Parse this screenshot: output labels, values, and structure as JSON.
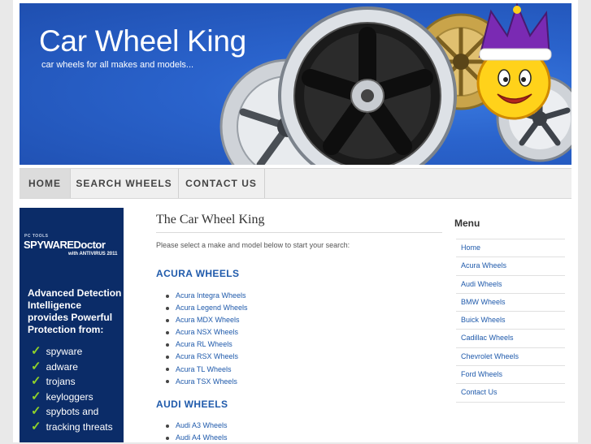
{
  "header": {
    "site_title": "Car Wheel King",
    "tagline": "car wheels for all makes and models..."
  },
  "nav": {
    "items": [
      {
        "label": "HOME",
        "active": true
      },
      {
        "label": "SEARCH WHEELS",
        "active": false
      },
      {
        "label": "CONTACT US",
        "active": false
      }
    ]
  },
  "ad": {
    "brand_small": "PC TOOLS",
    "brand": "SPYWAREDoctor",
    "brand_sub": "with ANTIVIRUS 2011",
    "headline": "Advanced Detection Intelligence provides Powerful Protection from:",
    "items": [
      "spyware",
      "adware",
      "trojans",
      "keyloggers",
      "spybots and",
      "tracking threats"
    ]
  },
  "main": {
    "title": "The Car Wheel King",
    "intro": "Please select a make and model below to start your search:",
    "sections": [
      {
        "title": "ACURA WHEELS",
        "items": [
          "Acura Integra Wheels",
          "Acura Legend Wheels",
          "Acura MDX Wheels",
          "Acura NSX Wheels",
          "Acura RL Wheels",
          "Acura RSX Wheels",
          "Acura TL Wheels",
          "Acura TSX Wheels"
        ]
      },
      {
        "title": "AUDI WHEELS",
        "items": [
          "Audi A3 Wheels",
          "Audi A4 Wheels"
        ]
      }
    ]
  },
  "sidebar": {
    "title": "Menu",
    "items": [
      "Home",
      "Acura Wheels",
      "Audi Wheels",
      "BMW Wheels",
      "Buick Wheels",
      "Cadillac Wheels",
      "Chevrolet Wheels",
      "Ford Wheels",
      "Contact Us"
    ]
  },
  "colors": {
    "banner_blue": "#2a63cc",
    "link_blue": "#1f5aab",
    "ad_navy": "#0b2c68",
    "check_green": "#8fd12a"
  }
}
